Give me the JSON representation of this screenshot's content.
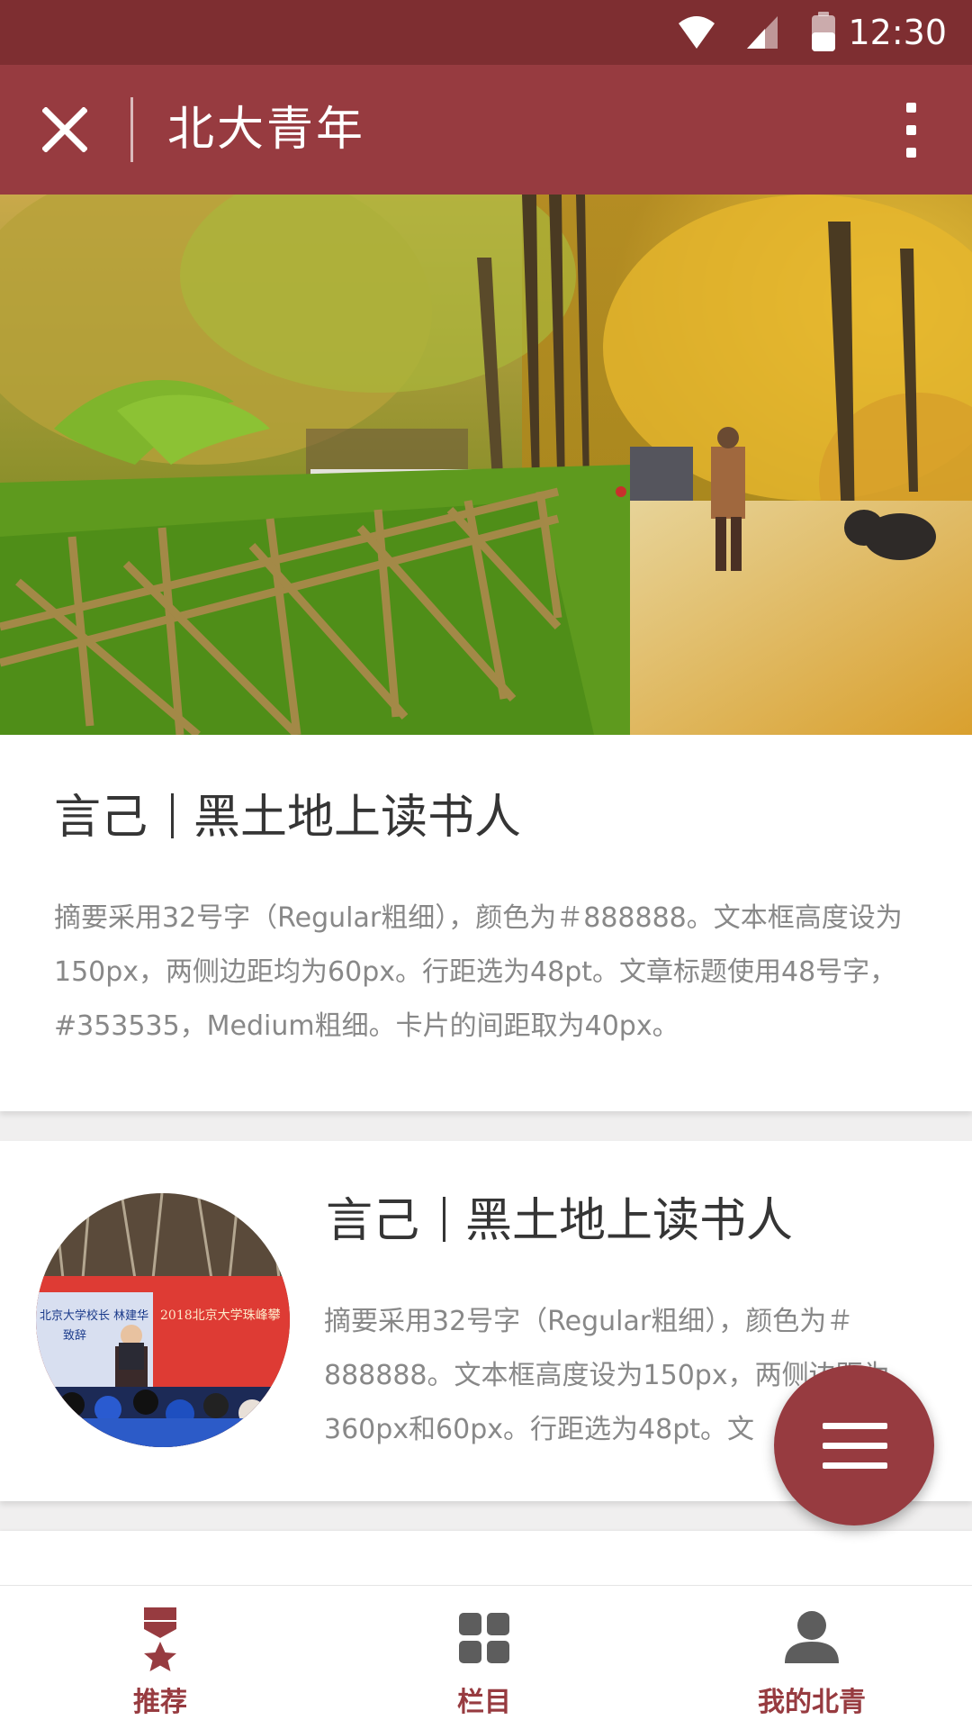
{
  "status_bar": {
    "time": "12:30"
  },
  "app_bar": {
    "title": "北大青年"
  },
  "articles": [
    {
      "title": "言己",
      "subtitle": "黑土地上读书人",
      "summary": "摘要采用32号字（Regular粗细），颜色为＃888888。文本框高度设为150px，两侧边距均为60px。行距选为48pt。文章标题使用48号字，#353535，Medium粗细。卡片的间距取为40px。"
    },
    {
      "title": "言己",
      "subtitle": "黑土地上读书人",
      "summary": "摘要采用32号字（Regular粗细），颜色为＃888888。文本框高度设为150px，两侧边距为360px和60px。行距选为48pt。文",
      "thumbnail_text": {
        "banner": "2018北京大学珠峰攀",
        "screen_line1": "北京大学校长 林建华",
        "screen_line2": "致辞"
      }
    }
  ],
  "bottom_nav": [
    {
      "label": "推荐",
      "icon": "medal-star-icon",
      "active": true
    },
    {
      "label": "栏目",
      "icon": "grid-icon",
      "active": false
    },
    {
      "label": "我的北青",
      "icon": "person-icon",
      "active": false
    }
  ],
  "colors": {
    "status_bar": "#7e2e31",
    "primary": "#973b40",
    "title_text": "#353535",
    "summary_text": "#888888",
    "nav_active_icon": "#973b40",
    "nav_inactive_icon": "#5d5d5d",
    "nav_label": "#973b40"
  }
}
